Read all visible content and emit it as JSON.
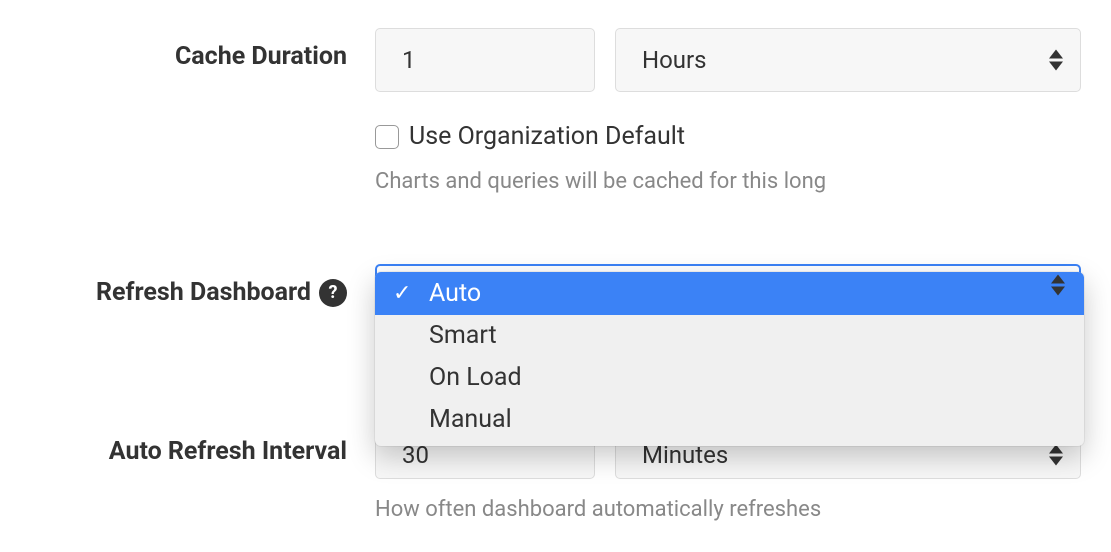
{
  "cacheDuration": {
    "label": "Cache Duration",
    "value": "1",
    "unit": "Hours",
    "useOrgDefaultLabel": "Use Organization Default",
    "helpText": "Charts and queries will be cached for this long"
  },
  "refreshDashboard": {
    "label": "Refresh Dashboard",
    "options": {
      "o0": "Auto",
      "o1": "Smart",
      "o2": "On Load",
      "o3": "Manual"
    },
    "selected": "Auto"
  },
  "autoRefreshInterval": {
    "label": "Auto Refresh Interval",
    "value": "30",
    "unit": "Minutes",
    "helpText": "How often dashboard automatically refreshes"
  }
}
